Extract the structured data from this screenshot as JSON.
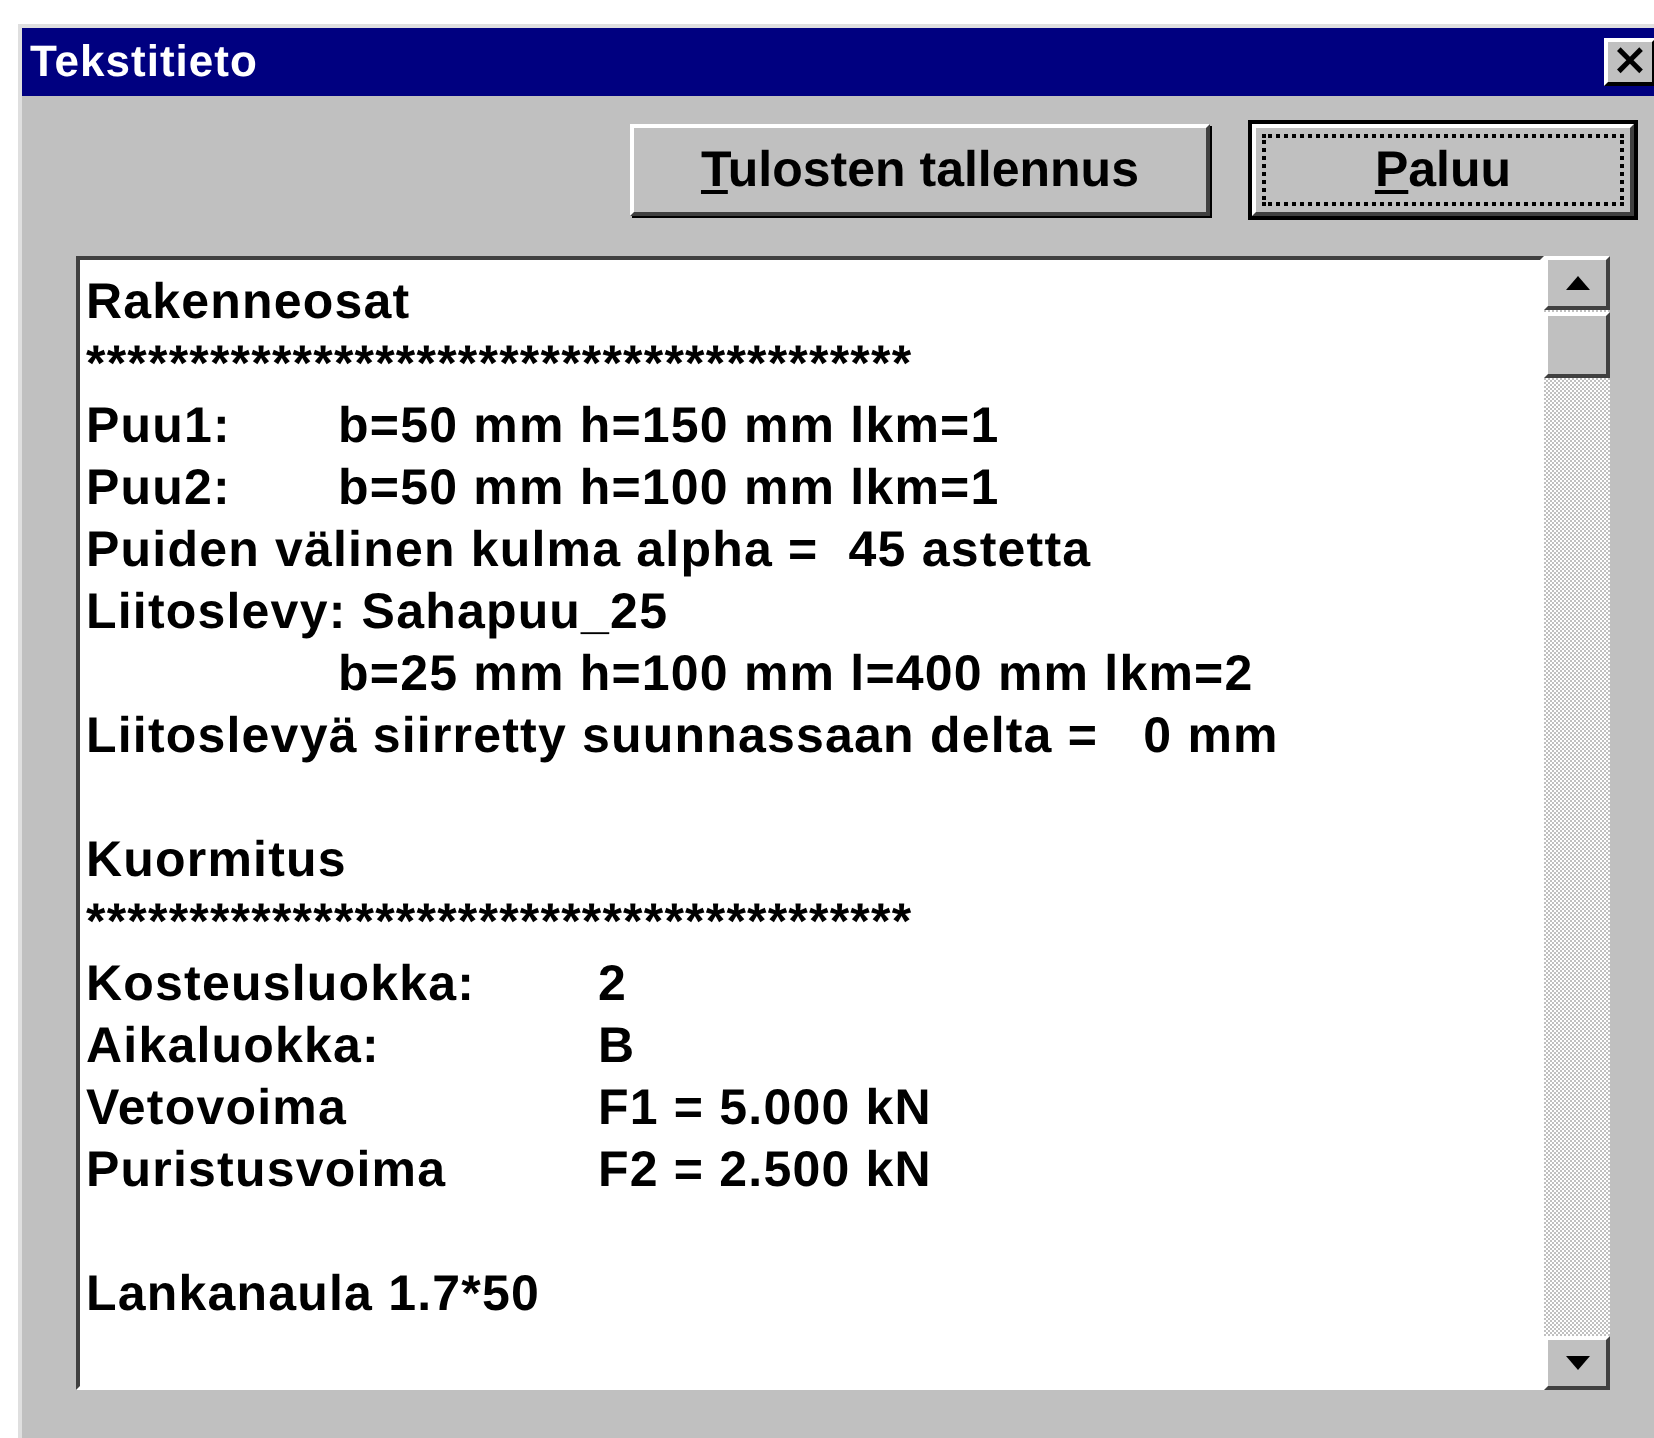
{
  "window": {
    "title": "Tekstitieto",
    "close": "×"
  },
  "buttons": [
    {
      "label": "Tulosten tallennus",
      "underline_first": true,
      "focused": false
    },
    {
      "label": "Paluu",
      "underline_first": true,
      "focused": true
    }
  ],
  "lines": [
    {
      "kind": "text",
      "text": "Rakenneosat"
    },
    {
      "kind": "text",
      "text": "****************************************"
    },
    {
      "kind": "short_pair",
      "label": "Puu1:",
      "value": "b=50 mm h=150 mm lkm=1"
    },
    {
      "kind": "short_pair",
      "label": "Puu2:",
      "value": "b=50 mm h=100 mm lkm=1"
    },
    {
      "kind": "text",
      "text": "Puiden välinen kulma alpha =  45 astetta"
    },
    {
      "kind": "text",
      "text": "Liitoslevy: Sahapuu_25"
    },
    {
      "kind": "indent",
      "text": "b=25 mm h=100 mm l=400 mm lkm=2"
    },
    {
      "kind": "text",
      "text": "Liitoslevyä siirretty suunnassaan delta =   0 mm"
    },
    {
      "kind": "blank"
    },
    {
      "kind": "text",
      "text": "Kuormitus"
    },
    {
      "kind": "text",
      "text": "****************************************"
    },
    {
      "kind": "long_pair",
      "label": "Kosteusluokka:",
      "value": "2"
    },
    {
      "kind": "long_pair",
      "label": "Aikaluokka:",
      "value": "B"
    },
    {
      "kind": "long_pair",
      "label": "Vetovoima",
      "value": "F1 = 5.000 kN"
    },
    {
      "kind": "long_pair",
      "label": "Puristusvoima",
      "value": "F2 = 2.500 kN"
    },
    {
      "kind": "blank"
    },
    {
      "kind": "text",
      "text": "Lankanaula 1.7*50"
    }
  ]
}
